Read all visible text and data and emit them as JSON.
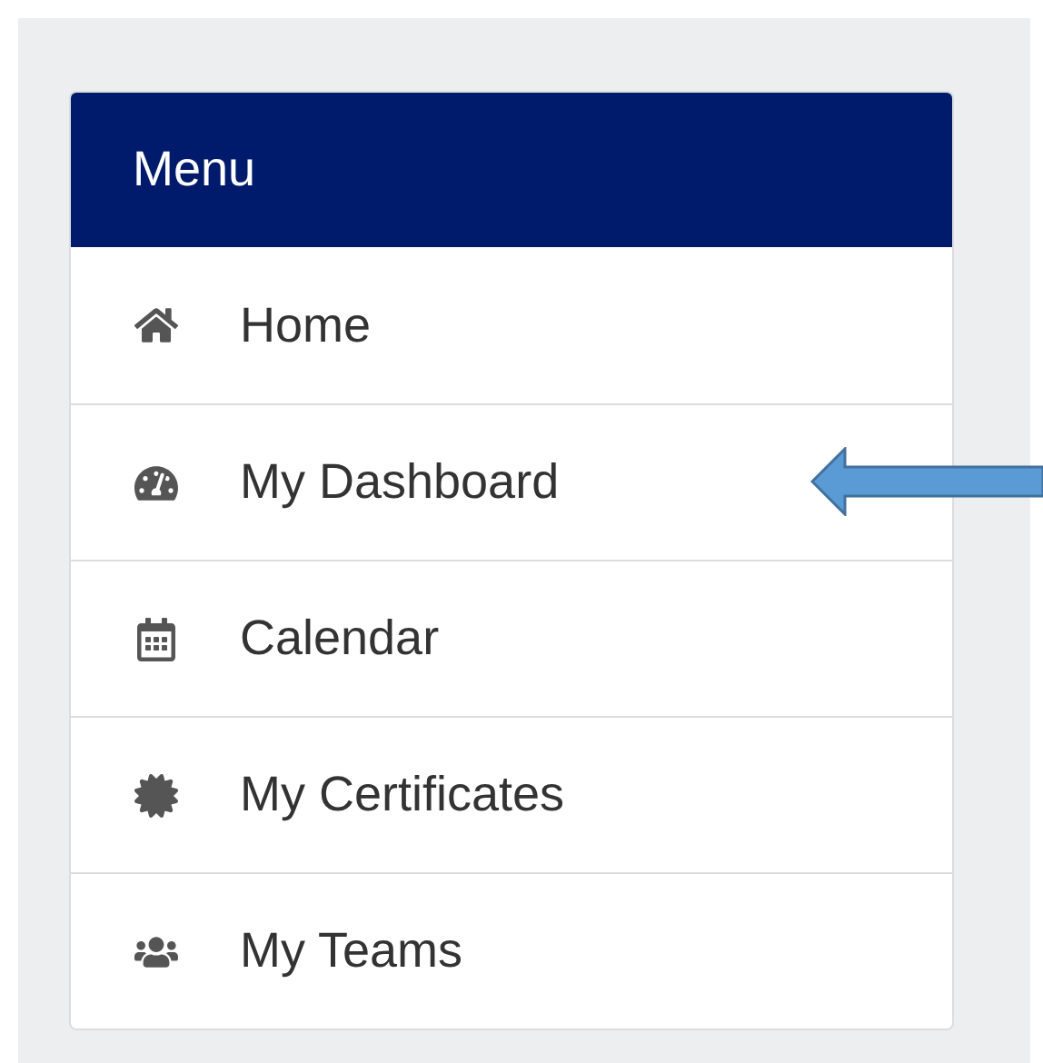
{
  "menu": {
    "title": "Menu",
    "items": [
      {
        "label": "Home"
      },
      {
        "label": "My Dashboard"
      },
      {
        "label": "Calendar"
      },
      {
        "label": "My Certificates"
      },
      {
        "label": "My Teams"
      }
    ]
  }
}
